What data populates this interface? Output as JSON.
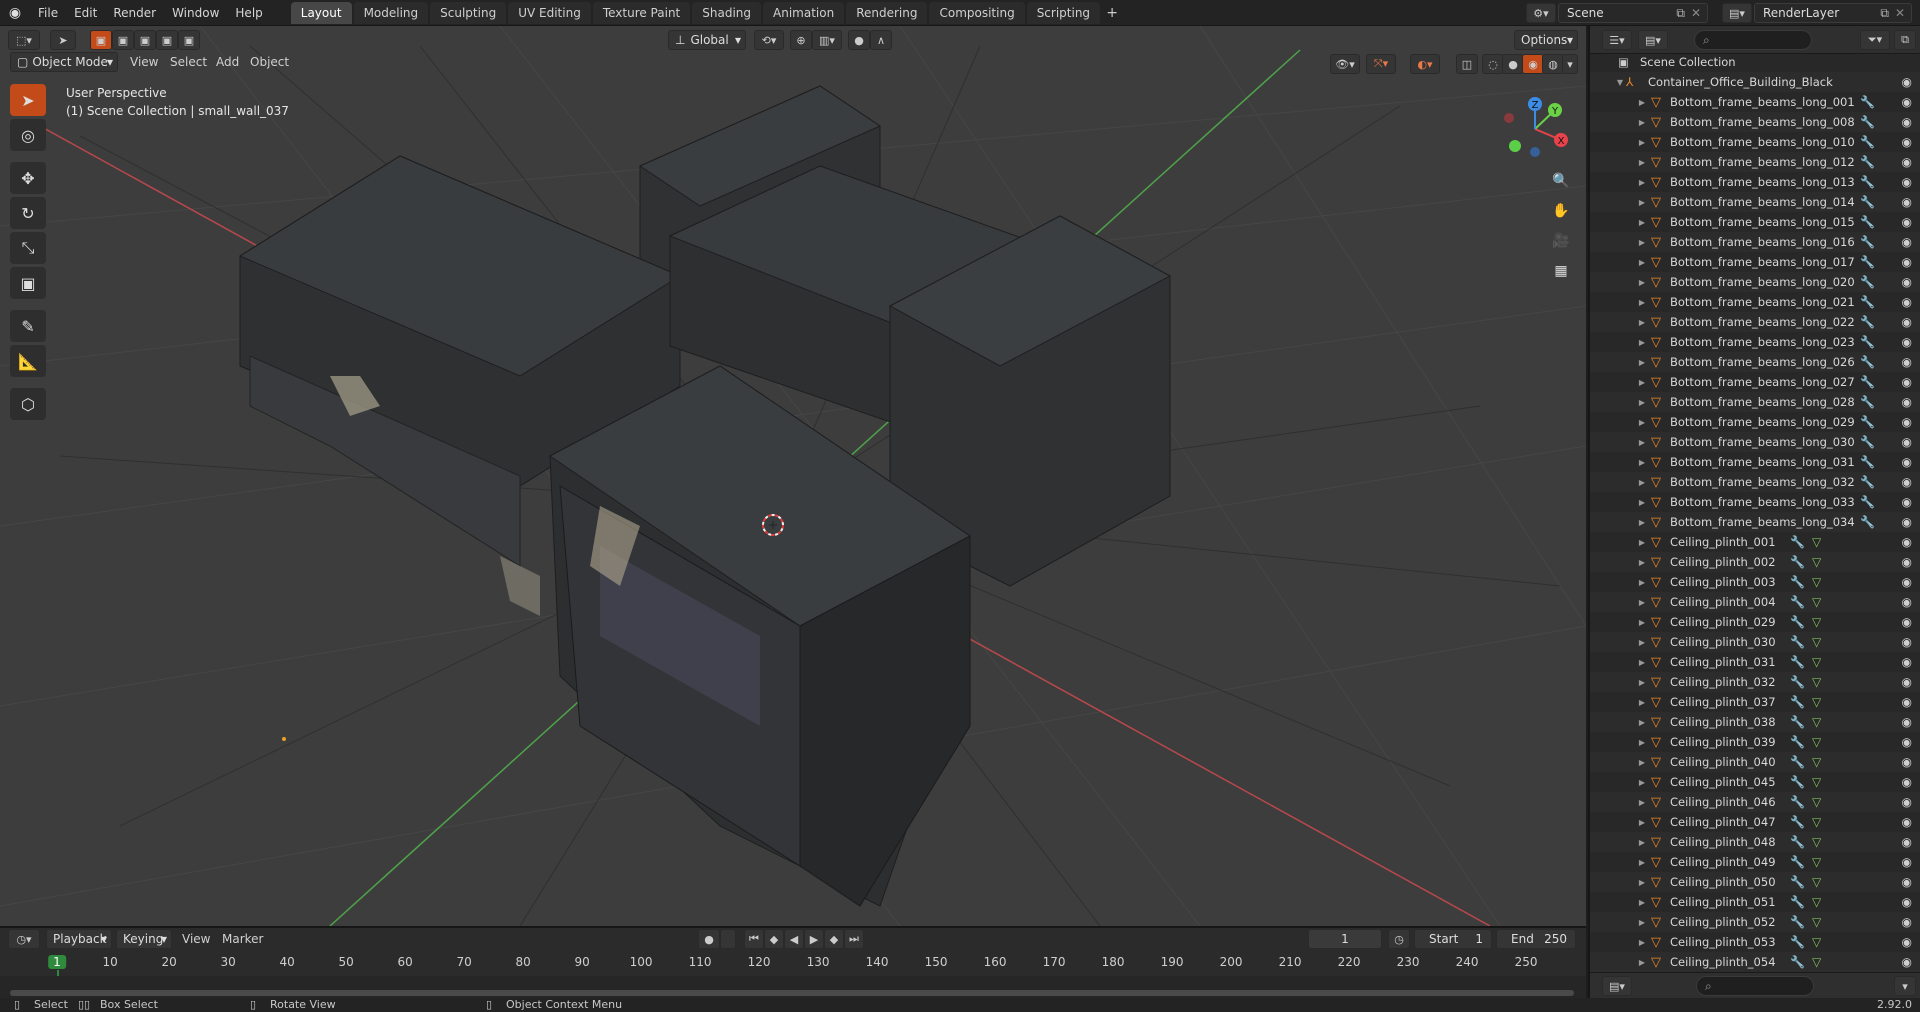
{
  "topbar": {
    "menus": [
      "File",
      "Edit",
      "Render",
      "Window",
      "Help"
    ],
    "workspaces": [
      "Layout",
      "Modeling",
      "Sculpting",
      "UV Editing",
      "Texture Paint",
      "Shading",
      "Animation",
      "Rendering",
      "Compositing",
      "Scripting"
    ],
    "active_workspace": "Layout",
    "add_tab": "+",
    "scene": "Scene",
    "view_layer": "RenderLayer"
  },
  "viewport_header": {
    "mode": "Object Mode",
    "menus": [
      "View",
      "Select",
      "Add",
      "Object"
    ],
    "orientation": "Global",
    "options": "Options"
  },
  "viewport": {
    "view_name": "User Perspective",
    "context": "(1) Scene Collection | small_wall_037",
    "gizmo": {
      "x": "X",
      "y": "Y",
      "z": "Z"
    }
  },
  "outliner": {
    "root": "Scene Collection",
    "parent": "Container_Office_Building_Black",
    "objects": [
      "Bottom_frame_beams_long_001",
      "Bottom_frame_beams_long_008",
      "Bottom_frame_beams_long_010",
      "Bottom_frame_beams_long_012",
      "Bottom_frame_beams_long_013",
      "Bottom_frame_beams_long_014",
      "Bottom_frame_beams_long_015",
      "Bottom_frame_beams_long_016",
      "Bottom_frame_beams_long_017",
      "Bottom_frame_beams_long_020",
      "Bottom_frame_beams_long_021",
      "Bottom_frame_beams_long_022",
      "Bottom_frame_beams_long_023",
      "Bottom_frame_beams_long_026",
      "Bottom_frame_beams_long_027",
      "Bottom_frame_beams_long_028",
      "Bottom_frame_beams_long_029",
      "Bottom_frame_beams_long_030",
      "Bottom_frame_beams_long_031",
      "Bottom_frame_beams_long_032",
      "Bottom_frame_beams_long_033",
      "Bottom_frame_beams_long_034",
      "Ceiling_plinth_001",
      "Ceiling_plinth_002",
      "Ceiling_plinth_003",
      "Ceiling_plinth_004",
      "Ceiling_plinth_029",
      "Ceiling_plinth_030",
      "Ceiling_plinth_031",
      "Ceiling_plinth_032",
      "Ceiling_plinth_037",
      "Ceiling_plinth_038",
      "Ceiling_plinth_039",
      "Ceiling_plinth_040",
      "Ceiling_plinth_045",
      "Ceiling_plinth_046",
      "Ceiling_plinth_047",
      "Ceiling_plinth_048",
      "Ceiling_plinth_049",
      "Ceiling_plinth_050",
      "Ceiling_plinth_051",
      "Ceiling_plinth_052",
      "Ceiling_plinth_053",
      "Ceiling_plinth_054"
    ]
  },
  "timeline": {
    "menus": [
      "Playback",
      "Keying",
      "View",
      "Marker"
    ],
    "current_frame": "1",
    "start_label": "Start",
    "start": "1",
    "end_label": "End",
    "end": "250",
    "ticks": [
      "1",
      "10",
      "20",
      "30",
      "40",
      "50",
      "60",
      "70",
      "80",
      "90",
      "100",
      "110",
      "120",
      "130",
      "140",
      "150",
      "160",
      "170",
      "180",
      "190",
      "200",
      "210",
      "220",
      "230",
      "240",
      "250"
    ]
  },
  "statusbar": {
    "select": "Select",
    "box_select": "Box Select",
    "rotate_view": "Rotate View",
    "context_menu": "Object Context Menu",
    "version": "2.92.0"
  },
  "colors": {
    "accent": "#c34b1a",
    "object_icon": "#e8862a",
    "axis_x": "#e8434a",
    "axis_y": "#6bd246",
    "axis_z": "#3c8ce6"
  }
}
